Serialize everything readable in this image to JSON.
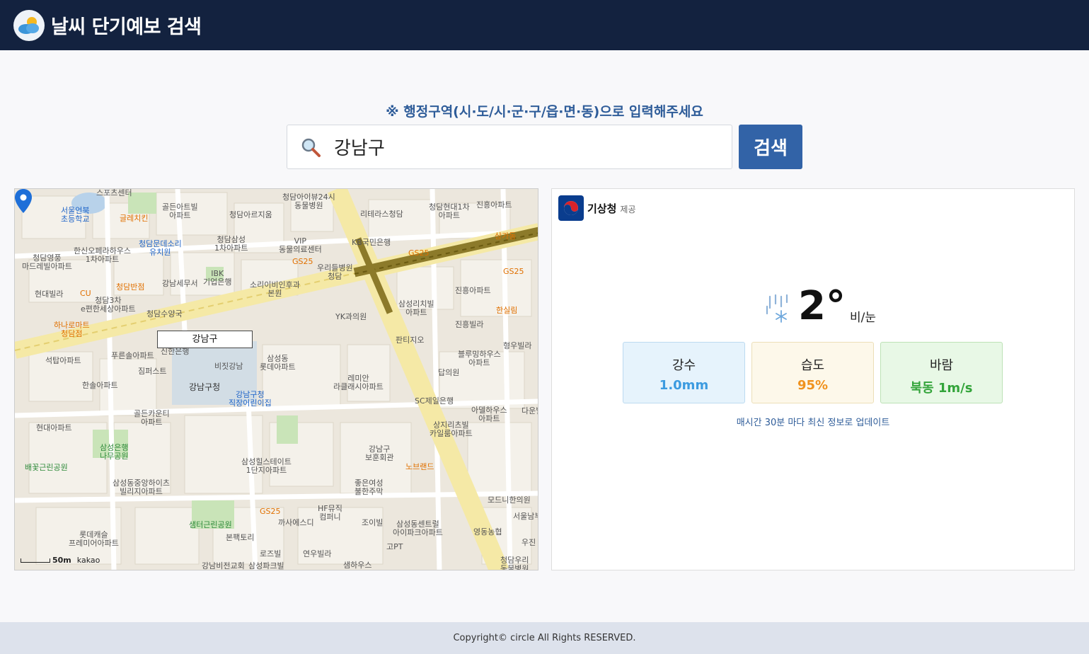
{
  "header": {
    "title": "날씨 단기예보 검색"
  },
  "search": {
    "hint": "※ 행정구역(시·도/시·군·구/읍·면·동)으로 입력해주세요",
    "value": "강남구",
    "button_label": "검색"
  },
  "map": {
    "marker_label": "강남구",
    "labels": [
      {
        "text": "스포츠센터",
        "c": ""
      },
      {
        "text": "서울언북\n초등학교",
        "c": "blue"
      },
      {
        "text": "골든아트빌\n아파트",
        "c": ""
      },
      {
        "text": "청담아이뷰24시\n동물병원",
        "c": ""
      },
      {
        "text": "리테라스청담",
        "c": ""
      },
      {
        "text": "청담현대1차\n아파트",
        "c": ""
      },
      {
        "text": "진흥아파트",
        "c": ""
      },
      {
        "text": "글레치킨",
        "c": "orange"
      },
      {
        "text": "청담아르지움",
        "c": ""
      },
      {
        "text": "청담문데소리\n유치원",
        "c": "blue"
      },
      {
        "text": "청담삼성\n1차아파트",
        "c": ""
      },
      {
        "text": "VIP\n동물의료센터",
        "c": ""
      },
      {
        "text": "KB국민은행",
        "c": ""
      },
      {
        "text": "한신오페라하우스\n1차아파트",
        "c": ""
      },
      {
        "text": "청담영풍\n마드레빌아파트",
        "c": ""
      },
      {
        "text": "GS25",
        "c": "orange"
      },
      {
        "text": "우리들병원\n청담",
        "c": ""
      },
      {
        "text": "IBK\n기업은행",
        "c": ""
      },
      {
        "text": "강남세무서",
        "c": ""
      },
      {
        "text": "소리이비인후과\n본원",
        "c": ""
      },
      {
        "text": "청담반점",
        "c": "orange"
      },
      {
        "text": "현대빌라",
        "c": ""
      },
      {
        "text": "CU",
        "c": "orange"
      },
      {
        "text": "청담3차\ne편한세상아파트",
        "c": ""
      },
      {
        "text": "청담수양국",
        "c": ""
      },
      {
        "text": "삼성리치빌\n아파트",
        "c": ""
      },
      {
        "text": "진흥아파트",
        "c": ""
      },
      {
        "text": "한실림",
        "c": "orange"
      },
      {
        "text": "YK과의원",
        "c": ""
      },
      {
        "text": "진흥빌라",
        "c": ""
      },
      {
        "text": "하나로마트\n청담점",
        "c": "orange"
      },
      {
        "text": "푸른솔아파트",
        "c": ""
      },
      {
        "text": "신한은행",
        "c": ""
      },
      {
        "text": "판티지오",
        "c": ""
      },
      {
        "text": "형우빌라",
        "c": ""
      },
      {
        "text": "석탑아파트",
        "c": ""
      },
      {
        "text": "삼성동\n롯데아파트",
        "c": ""
      },
      {
        "text": "비짓강남",
        "c": ""
      },
      {
        "text": "블루밍하우스\n아파트",
        "c": ""
      },
      {
        "text": "짐퍼스트",
        "c": ""
      },
      {
        "text": "강남구청",
        "c": "dark"
      },
      {
        "text": "레미안\n라클래시아파트",
        "c": ""
      },
      {
        "text": "답의원",
        "c": ""
      },
      {
        "text": "한솔아파트",
        "c": ""
      },
      {
        "text": "강남구청\n직장어린이집",
        "c": "blue"
      },
      {
        "text": "SC제일은행",
        "c": ""
      },
      {
        "text": "골든카운티\n아파트",
        "c": ""
      },
      {
        "text": "아델하우스\n아파트",
        "c": ""
      },
      {
        "text": "다운빌",
        "c": ""
      },
      {
        "text": "현대아파트",
        "c": ""
      },
      {
        "text": "상지리츠빌\n카일룸아파트",
        "c": ""
      },
      {
        "text": "삼성은행\n나무공원",
        "c": "green"
      },
      {
        "text": "강남구\n보훈회관",
        "c": ""
      },
      {
        "text": "삼성힐스테이트\n1단지아파트",
        "c": ""
      },
      {
        "text": "노브랜드",
        "c": "orange"
      },
      {
        "text": "배꽃근린공원",
        "c": "green"
      },
      {
        "text": "삼성동중앙하이츠\n빌리지아파트",
        "c": ""
      },
      {
        "text": "좋은여성\n불한주막",
        "c": ""
      },
      {
        "text": "모드니한의원",
        "c": ""
      },
      {
        "text": "HF뮤직\n컴퍼니",
        "c": ""
      },
      {
        "text": "서울남부",
        "c": ""
      },
      {
        "text": "GS25",
        "c": "orange"
      },
      {
        "text": "까사에스디",
        "c": ""
      },
      {
        "text": "조이빌",
        "c": ""
      },
      {
        "text": "삼성동센트럴\n아이파크아파트",
        "c": ""
      },
      {
        "text": "샘터근린공원",
        "c": "green"
      },
      {
        "text": "롯데캐슬\n프레미어아파트",
        "c": ""
      },
      {
        "text": "영동농협",
        "c": ""
      },
      {
        "text": "본팩토리",
        "c": ""
      },
      {
        "text": "고PT",
        "c": ""
      },
      {
        "text": "로즈빌",
        "c": ""
      },
      {
        "text": "연우빌라",
        "c": ""
      },
      {
        "text": "청담우리\n동물병원",
        "c": ""
      },
      {
        "text": "강남비전교회",
        "c": ""
      },
      {
        "text": "삼성파크빌",
        "c": ""
      },
      {
        "text": "샘하우스",
        "c": ""
      },
      {
        "text": "우진",
        "c": ""
      },
      {
        "text": "GS25",
        "c": "orange"
      },
      {
        "text": "GS25",
        "c": "orange"
      },
      {
        "text": "상가동",
        "c": "orange"
      }
    ],
    "scale_text": "50m",
    "brand": "kakao"
  },
  "weather": {
    "provider_name": "기상청",
    "provider_suffix": "제공",
    "temperature": "2°",
    "condition": "비/눈",
    "cards": {
      "rain": {
        "title": "강수",
        "value": "1.0mm"
      },
      "humidity": {
        "title": "습도",
        "value": "95%"
      },
      "wind": {
        "title": "바람",
        "value": "북동 1m/s"
      }
    },
    "update_note": "매시간 30분 마다 최신 정보로 업데이트"
  },
  "footer": {
    "copyright": "Copyright© circle All Rights RESERVED."
  }
}
